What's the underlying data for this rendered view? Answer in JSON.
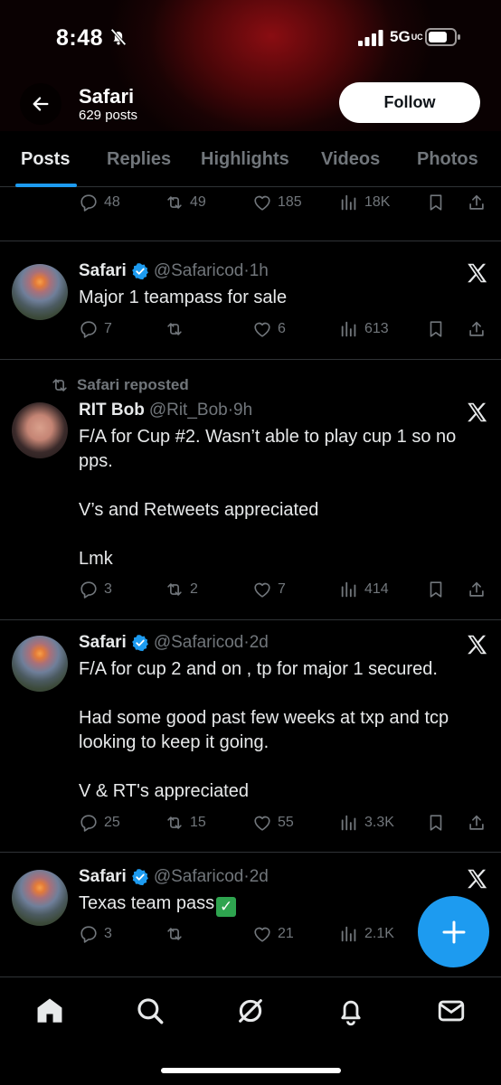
{
  "status_bar": {
    "time": "8:48",
    "network": "5G",
    "network_sub": "UC"
  },
  "header": {
    "title": "Safari",
    "subtitle": "629 posts",
    "follow_label": "Follow"
  },
  "tabs": [
    {
      "label": "Posts",
      "active": true
    },
    {
      "label": "Replies",
      "active": false
    },
    {
      "label": "Highlights",
      "active": false
    },
    {
      "label": "Videos",
      "active": false
    },
    {
      "label": "Photos",
      "active": false
    }
  ],
  "top_actions": {
    "replies": "48",
    "reposts": "49",
    "likes": "185",
    "views": "18K"
  },
  "posts": [
    {
      "name": "Safari",
      "verified": true,
      "handle": "@Safaricod",
      "time": "1h",
      "text": "Major 1 teampass for sale",
      "replies": "7",
      "reposts": "",
      "likes": "6",
      "views": "613"
    },
    {
      "repost_label": "Safari reposted",
      "name": "RIT Bob",
      "verified": false,
      "handle": "@Rit_Bob",
      "time": "9h",
      "text": "F/A for Cup #2. Wasn’t able to play cup 1 so no pps.\n\nV’s and Retweets appreciated\n\nLmk",
      "replies": "3",
      "reposts": "2",
      "likes": "7",
      "views": "414"
    },
    {
      "name": "Safari",
      "verified": true,
      "handle": "@Safaricod",
      "time": "2d",
      "text": "F/A for cup 2 and on , tp for major 1 secured.\n\nHad some good past few weeks at txp and tcp looking to keep it going.\n\nV & RT's appreciated",
      "replies": "25",
      "reposts": "15",
      "likes": "55",
      "views": "3.3K"
    },
    {
      "name": "Safari",
      "verified": true,
      "handle": "@Safaricod",
      "time": "2d",
      "text": "Texas team pass",
      "replies": "3",
      "reposts": "",
      "likes": "21",
      "views": "2.1K"
    }
  ],
  "colors": {
    "accent": "#1d9bf0",
    "muted": "#71767b",
    "divider": "#2f3336",
    "check": "#2ea44f"
  },
  "icons": [
    "back-arrow-icon",
    "reply-icon",
    "repost-icon",
    "like-icon",
    "views-icon",
    "bookmark-icon",
    "share-icon",
    "x-logo-icon",
    "verified-badge-icon",
    "compose-plus-icon",
    "home-icon",
    "search-icon",
    "grok-icon",
    "notifications-icon",
    "messages-icon"
  ]
}
